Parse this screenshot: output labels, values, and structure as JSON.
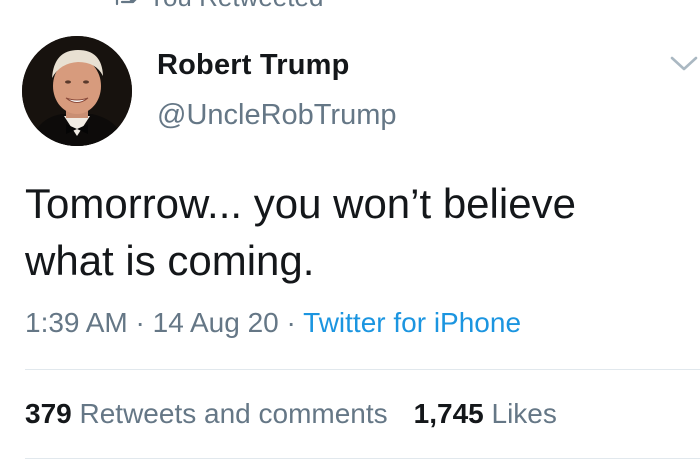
{
  "retweet_banner": {
    "text": "You Retweeted",
    "icon": "retweet-icon"
  },
  "author": {
    "name": "Robert Trump",
    "handle": "@UncleRobTrump",
    "avatar": "profile-photo"
  },
  "menu_icon": "chevron-down-icon",
  "tweet": {
    "text_line1": "Tomorrow... you won’t believe",
    "text_line2": "what is coming."
  },
  "meta": {
    "time": "1:39 AM",
    "separator1": " · ",
    "date": "14 Aug 20",
    "separator2": " · ",
    "source": "Twitter for iPhone"
  },
  "stats": {
    "retweets_count": "379",
    "retweets_label": "Retweets and comments",
    "likes_count": "1,745",
    "likes_label": "Likes"
  },
  "colors": {
    "text_primary": "#14171a",
    "text_secondary": "#657786",
    "link": "#1b95e0",
    "divider": "#e1e8ed"
  }
}
